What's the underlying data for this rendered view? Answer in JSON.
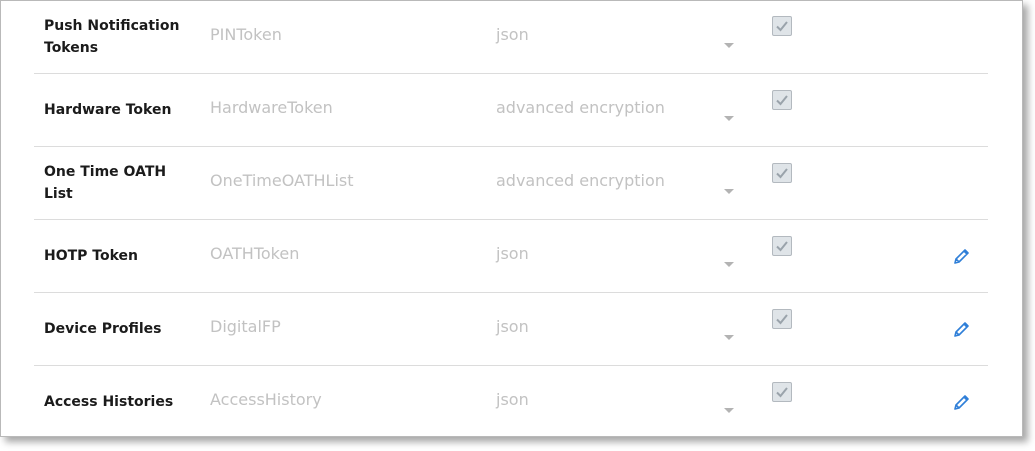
{
  "rows": [
    {
      "name": "Push Notification Tokens",
      "type": "PINToken",
      "format": "json",
      "checked": true,
      "editable": false
    },
    {
      "name": "Hardware Token",
      "type": "HardwareToken",
      "format": "advanced encryption",
      "checked": true,
      "editable": false
    },
    {
      "name": "One Time OATH List",
      "type": "OneTimeOATHList",
      "format": "advanced encryption",
      "checked": true,
      "editable": false
    },
    {
      "name": "HOTP Token",
      "type": "OATHToken",
      "format": "json",
      "checked": true,
      "editable": true
    },
    {
      "name": "Device Profiles",
      "type": "DigitalFP",
      "format": "json",
      "checked": true,
      "editable": true
    },
    {
      "name": "Access Histories",
      "type": "AccessHistory",
      "format": "json",
      "checked": true,
      "editable": true
    }
  ],
  "colors": {
    "edit_icon": "#2f7fd8",
    "check_bg": "#dfe4e8",
    "placeholder_text": "#c2c2c2"
  },
  "icons": {
    "checkbox": "checkmark-icon",
    "edit": "pencil-icon",
    "dropdown": "chevron-down-icon"
  }
}
